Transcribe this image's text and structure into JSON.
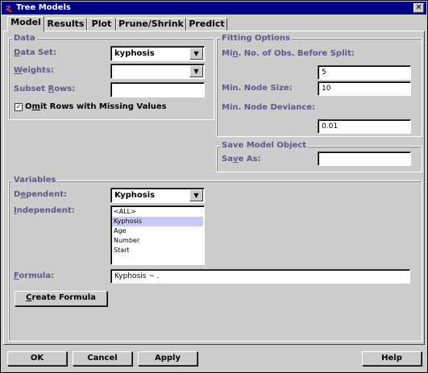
{
  "window": {
    "title": "Tree Models",
    "close_glyph": "✕"
  },
  "tabs": [
    {
      "label": "Model",
      "active": true
    },
    {
      "label": "Results",
      "active": false
    },
    {
      "label": "Plot",
      "active": false
    },
    {
      "label": "Prune/Shrink",
      "active": false
    },
    {
      "label": "Predict",
      "active": false
    }
  ],
  "data_group": {
    "title": "Data",
    "data_set": {
      "mn": "D",
      "label": "ata Set:",
      "value": "kyphosis"
    },
    "weights": {
      "mn": "W",
      "label": "eights:",
      "value": ""
    },
    "subset_rows": {
      "pre": "Subset ",
      "mn": "R",
      "label": "ows:",
      "value": ""
    },
    "omit_missing": {
      "pre": "O",
      "mn": "m",
      "label": "it Rows with Missing Values",
      "checked": true,
      "check_glyph": "✓"
    }
  },
  "fitting_group": {
    "title": "Fitting Options",
    "min_obs": {
      "pre": "Mi",
      "mn": "n",
      "label": ". No. of Obs. Before Split:",
      "value": "5"
    },
    "min_node_size": {
      "label": "Min. Node Size:",
      "value": "10"
    },
    "min_node_dev": {
      "label": "Min. Node Deviance:",
      "value": "0.01"
    }
  },
  "save_group": {
    "title": "Save Model Object",
    "save_as": {
      "pre": "Sa",
      "mn": "v",
      "label": "e As:",
      "value": ""
    }
  },
  "variables_group": {
    "title": "Variables",
    "dependent": {
      "pre": "D",
      "mn": "e",
      "label": "pendent:",
      "value": "Kyphosis"
    },
    "independent": {
      "mn": "I",
      "label": "ndependent:",
      "items": [
        "<ALL>",
        "Kyphosis",
        "Age",
        "Number",
        "Start"
      ],
      "selected_index": 1
    },
    "formula": {
      "mn": "F",
      "label": "ormula:",
      "value": "Kyphosis ~ ."
    },
    "create_formula": {
      "mn": "C",
      "label": "reate Formula"
    }
  },
  "buttons": {
    "ok": "OK",
    "cancel": "Cancel",
    "apply": "Apply",
    "help": "Help"
  },
  "icons": {
    "combo_arrow": "▼",
    "app_icon": "ʐ"
  },
  "colors": {
    "title_bar": "#000080",
    "label_text": "#5a5a8c",
    "background": "#cccccc",
    "selection": "#c8c8f4"
  }
}
